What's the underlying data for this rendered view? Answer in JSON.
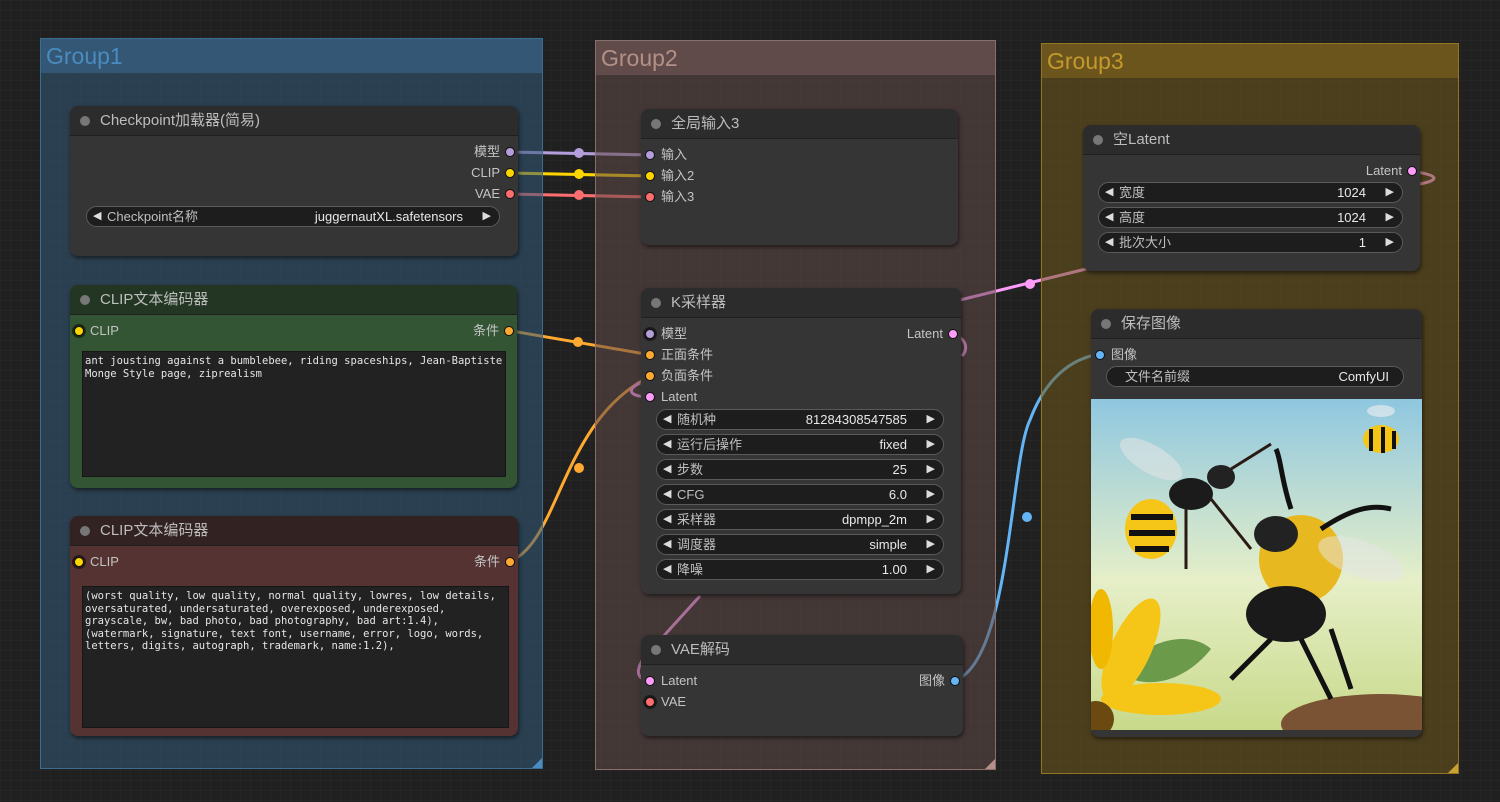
{
  "groups": [
    {
      "id": "g1",
      "title": "Group1",
      "color": "#335a79"
    },
    {
      "id": "g2",
      "title": "Group2",
      "color": "#604a48"
    },
    {
      "id": "g3",
      "title": "Group3",
      "color": "#70581c"
    }
  ],
  "nodes": {
    "checkpoint_loader": {
      "title": "Checkpoint加载器(简易)",
      "outputs": [
        "模型",
        "CLIP",
        "VAE"
      ],
      "widget": {
        "label": "Checkpoint名称",
        "value": "juggernautXL.safetensors"
      }
    },
    "clip_positive": {
      "title": "CLIP文本编码器",
      "input": "CLIP",
      "output": "条件",
      "text": "ant jousting against a bumblebee, riding spaceships, Jean-Baptiste Monge Style page, ziprealism"
    },
    "clip_negative": {
      "title": "CLIP文本编码器",
      "input": "CLIP",
      "output": "条件",
      "text": "(worst quality, low quality, normal quality, lowres, low details, oversaturated, undersaturated, overexposed, underexposed, grayscale, bw, bad photo, bad photography, bad art:1.4),\n(watermark, signature, text font, username, error, logo, words, letters, digits, autograph, trademark, name:1.2),"
    },
    "global_input": {
      "title": "全局输入3",
      "inputs": [
        "输入",
        "输入2",
        "输入3"
      ]
    },
    "ksampler": {
      "title": "K采样器",
      "inputs": [
        "模型",
        "正面条件",
        "负面条件",
        "Latent"
      ],
      "output": "Latent",
      "widgets": [
        {
          "label": "随机种",
          "value": "81284308547585"
        },
        {
          "label": "运行后操作",
          "value": "fixed"
        },
        {
          "label": "步数",
          "value": "25"
        },
        {
          "label": "CFG",
          "value": "6.0"
        },
        {
          "label": "采样器",
          "value": "dpmpp_2m"
        },
        {
          "label": "调度器",
          "value": "simple"
        },
        {
          "label": "降噪",
          "value": "1.00"
        }
      ]
    },
    "vae_decode": {
      "title": "VAE解码",
      "inputs": [
        "Latent",
        "VAE"
      ],
      "output": "图像"
    },
    "empty_latent": {
      "title": "空Latent",
      "output": "Latent",
      "widgets": [
        {
          "label": "宽度",
          "value": "1024"
        },
        {
          "label": "高度",
          "value": "1024"
        },
        {
          "label": "批次大小",
          "value": "1"
        }
      ]
    },
    "save_image": {
      "title": "保存图像",
      "input": "图像",
      "widget": {
        "label": "文件名前缀",
        "value": "ComfyUI"
      },
      "preview_description": "ant and bumblebee fighting in meadow with sunflower"
    }
  },
  "colors": {
    "model": "#b39ddb",
    "clip": "#ffd500",
    "vae": "#ff6e6e",
    "conditioning": "#ffa931",
    "latent": "#ff9cf9",
    "image": "#64b5f6"
  },
  "icons": {
    "arrow_left": "◀",
    "arrow_right": "▶"
  }
}
